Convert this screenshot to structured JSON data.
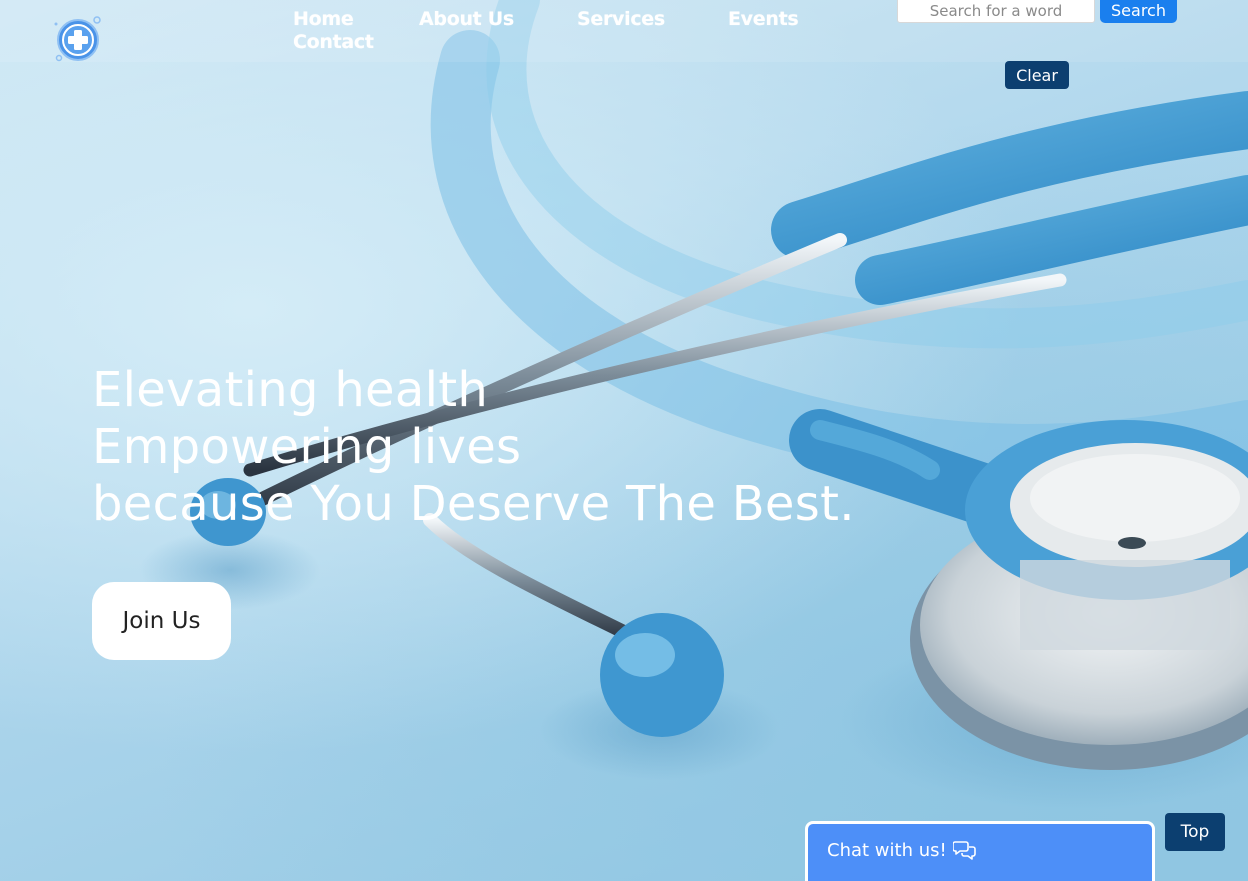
{
  "header": {
    "logo_icon": "medical-cross-icon",
    "nav": {
      "home": "Home",
      "about": "About Us",
      "services": "Services",
      "events": "Events",
      "contact": "Contact"
    },
    "search": {
      "placeholder": "Search for a word",
      "button_label": "Search",
      "clear_label": "Clear"
    }
  },
  "hero": {
    "background_image": "stethoscope-photo",
    "headline_lines": [
      "Elevating health",
      "Empowering lives",
      "because You Deserve The Best."
    ],
    "cta_label": "Join Us"
  },
  "chat": {
    "label": "Chat with us!",
    "icon": "chat-bubbles-icon"
  },
  "back_to_top": {
    "label": "Top"
  },
  "colors": {
    "primary_blue": "#1a7fee",
    "navy": "#0c3f70",
    "chat_blue": "#4d8ff8",
    "hero_light": "#cfe7f4",
    "hero_mid": "#aed6ec",
    "stethoscope_tube": "#3a95d0",
    "text_white": "#ffffff"
  }
}
